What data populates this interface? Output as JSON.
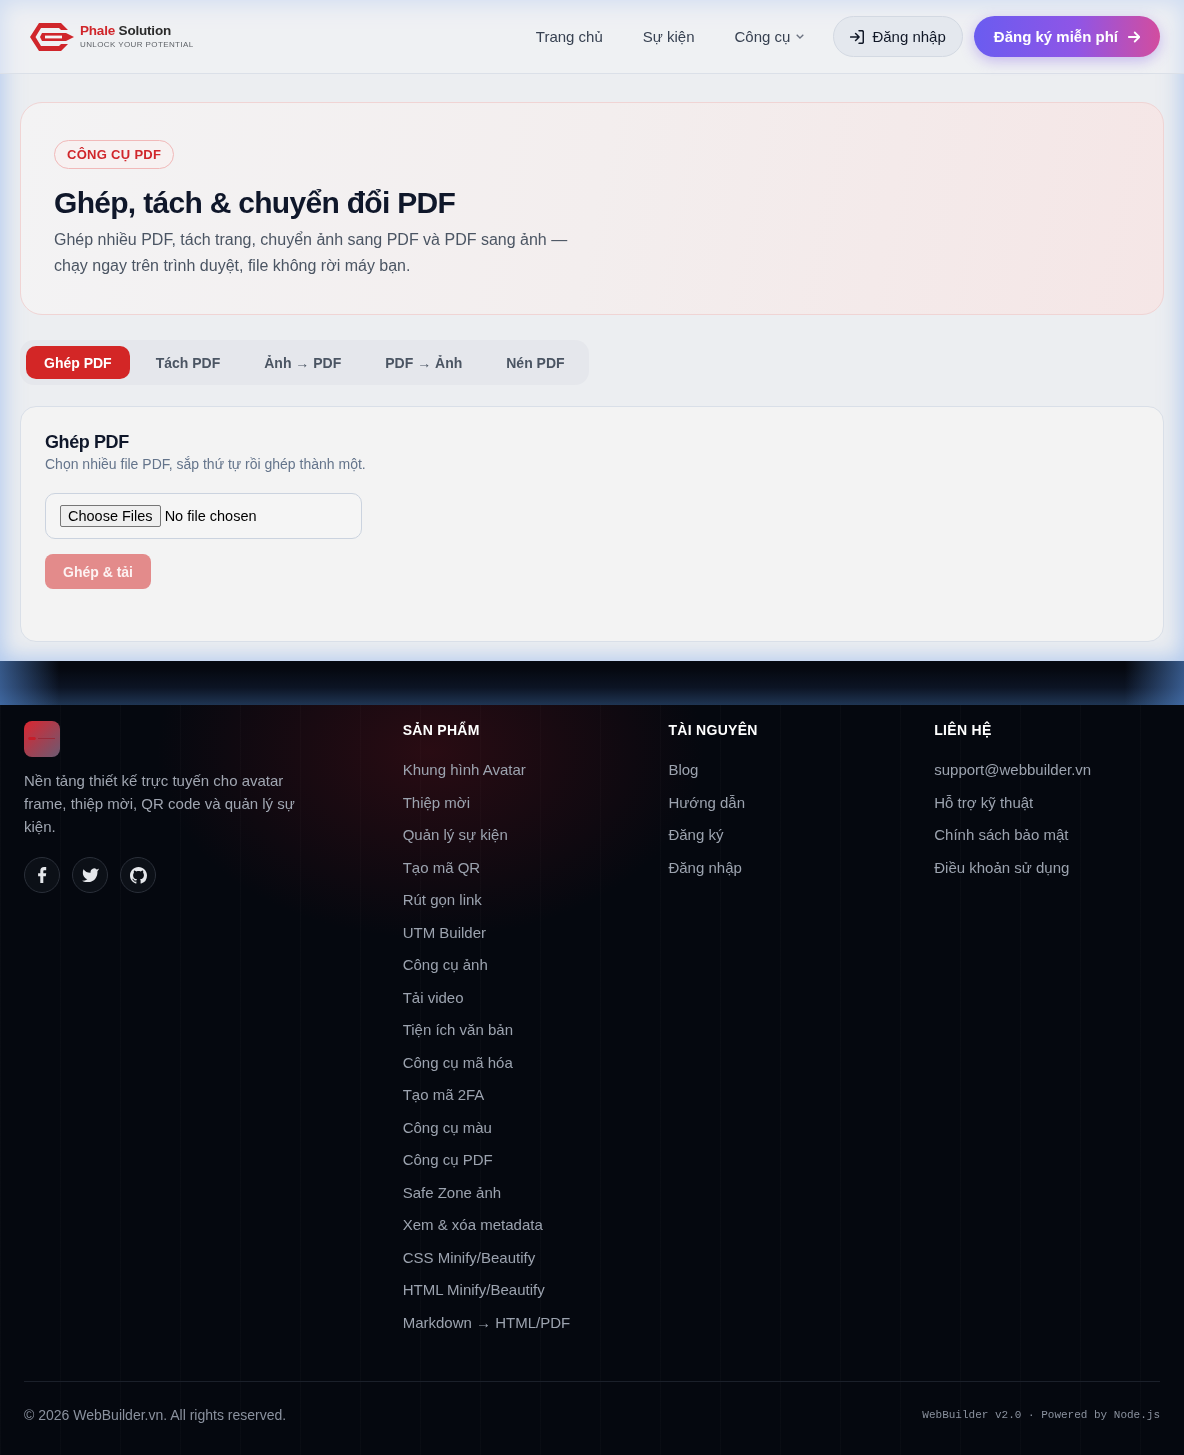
{
  "header": {
    "logo": {
      "brand_accent": "Phale",
      "brand_rest": "Solution",
      "tagline": "UNLOCK YOUR POTENTIAL"
    },
    "nav": [
      {
        "label": "Trang chủ",
        "kind": "link"
      },
      {
        "label": "Sự kiện",
        "kind": "link"
      },
      {
        "label": "Công cụ",
        "kind": "dropdown"
      }
    ],
    "login_button": "Đăng nhập",
    "signup_button": "Đăng ký miễn phí"
  },
  "hero": {
    "badge": "CÔNG CỤ PDF",
    "title": "Ghép, tách & chuyển đổi PDF",
    "description": "Ghép nhiều PDF, tách trang, chuyển ảnh sang PDF và PDF sang ảnh — chạy ngay trên trình duyệt, file không rời máy bạn."
  },
  "tabs": [
    {
      "label": "Ghép PDF",
      "selected": true
    },
    {
      "label": "Tách PDF",
      "selected": false
    },
    {
      "label": "Ảnh → PDF",
      "selected": false
    },
    {
      "label": "PDF → Ảnh",
      "selected": false
    },
    {
      "label": "Nén PDF",
      "selected": false
    }
  ],
  "tool": {
    "title": "Ghép PDF",
    "description": "Chọn nhiều file PDF, sắp thứ tự rồi ghép thành một.",
    "file_input": {
      "button": "Choose Files",
      "status": "No file chosen"
    },
    "action_button": {
      "label": "Ghép & tải",
      "disabled": true
    }
  },
  "footer": {
    "description": "Nền tảng thiết kế trực tuyến cho avatar frame, thiệp mời, QR code và quản lý sự kiện.",
    "columns": [
      {
        "heading": "SẢN PHẨM",
        "links": [
          "Khung hình Avatar",
          "Thiệp mời",
          "Quản lý sự kiện",
          "Tạo mã QR",
          "Rút gọn link",
          "UTM Builder",
          "Công cụ ảnh",
          "Tải video",
          "Tiện ích văn bản",
          "Công cụ mã hóa",
          "Tạo mã 2FA",
          "Công cụ màu",
          "Công cụ PDF",
          "Safe Zone ảnh",
          "Xem & xóa metadata",
          "CSS Minify/Beautify",
          "HTML Minify/Beautify",
          "Markdown → HTML/PDF"
        ]
      },
      {
        "heading": "TÀI NGUYÊN",
        "links": [
          "Blog",
          "Hướng dẫn",
          "Đăng ký",
          "Đăng nhập"
        ]
      },
      {
        "heading": "LIÊN HỆ",
        "links": [
          "support@webbuilder.vn",
          "Hỗ trợ kỹ thuật",
          "Chính sách bảo mật",
          "Điều khoản sử dụng"
        ]
      }
    ],
    "copyright": "© 2026 WebBuilder.vn. All rights reserved.",
    "version_note": "WebBuilder v2.0 · Powered by Node.js"
  }
}
